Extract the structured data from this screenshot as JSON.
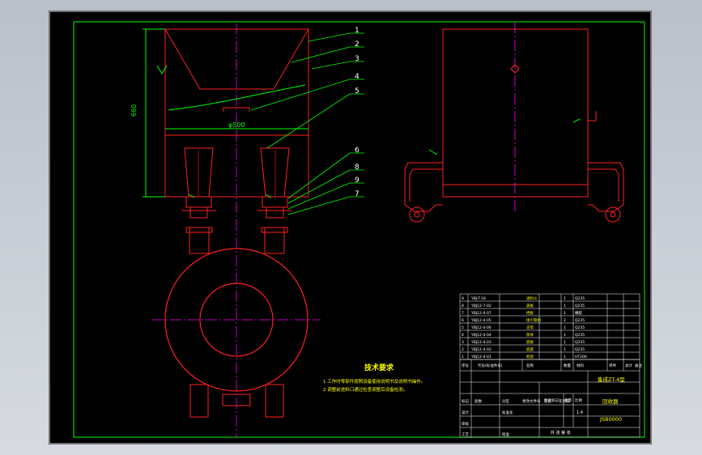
{
  "drawing": {
    "balloons": [
      "1",
      "2",
      "3",
      "4",
      "5",
      "6",
      "8",
      "9",
      "7"
    ],
    "dim_height": "660",
    "dim_diameter": "φ500",
    "notes_title": "技术要求",
    "notes": [
      "1 工作时零部件按照设备使用说明书及说明书操作。",
      "2 调整前进料口通过检查调整后设备检测。"
    ]
  },
  "title_block": {
    "drawing_title": "集成ZT-4型",
    "drawing_name": "回收器",
    "drawing_code": "JSB0000",
    "scale": "1:4",
    "header_cells": [
      "序号",
      "代号(标准件号)",
      "名称",
      "数量",
      "材料",
      "单件",
      "总计",
      "备注"
    ],
    "sign_cells": [
      "标记",
      "处数",
      "分区",
      "更改文件号",
      "签名",
      "年月日",
      "设计",
      "标准化",
      "审核",
      "工艺",
      "批准"
    ],
    "stage_cells": [
      "阶段标记",
      "重量",
      "比例"
    ],
    "footer": "共 张 第 张",
    "parts": [
      {
        "code": "YBJ-T-18",
        "name": "进料斗",
        "qty": "1",
        "mat": "Q235"
      },
      {
        "code": "YBJ12-7-02",
        "name": "盖板",
        "qty": "1",
        "mat": "Q235"
      },
      {
        "code": "YBJ12-4-07",
        "name": "挡板",
        "qty": "1",
        "mat": "橡胶"
      },
      {
        "code": "YBJ12-4-05",
        "name": "接引管组",
        "qty": "2",
        "mat": "Q235"
      },
      {
        "code": "YBJ12-4-06",
        "name": "支架",
        "qty": "1",
        "mat": "Q235"
      },
      {
        "code": "YBJ12-4-04",
        "name": "筒体",
        "qty": "1",
        "mat": "Q235"
      },
      {
        "code": "YBJ12-4-03",
        "name": "底板",
        "qty": "1",
        "mat": "Q235"
      },
      {
        "code": "YBJ12-4-02",
        "name": "底座",
        "qty": "1",
        "mat": "Q235"
      },
      {
        "code": "YBJ12-4-01",
        "name": "机架",
        "qty": "1",
        "mat": "HT200"
      }
    ]
  }
}
